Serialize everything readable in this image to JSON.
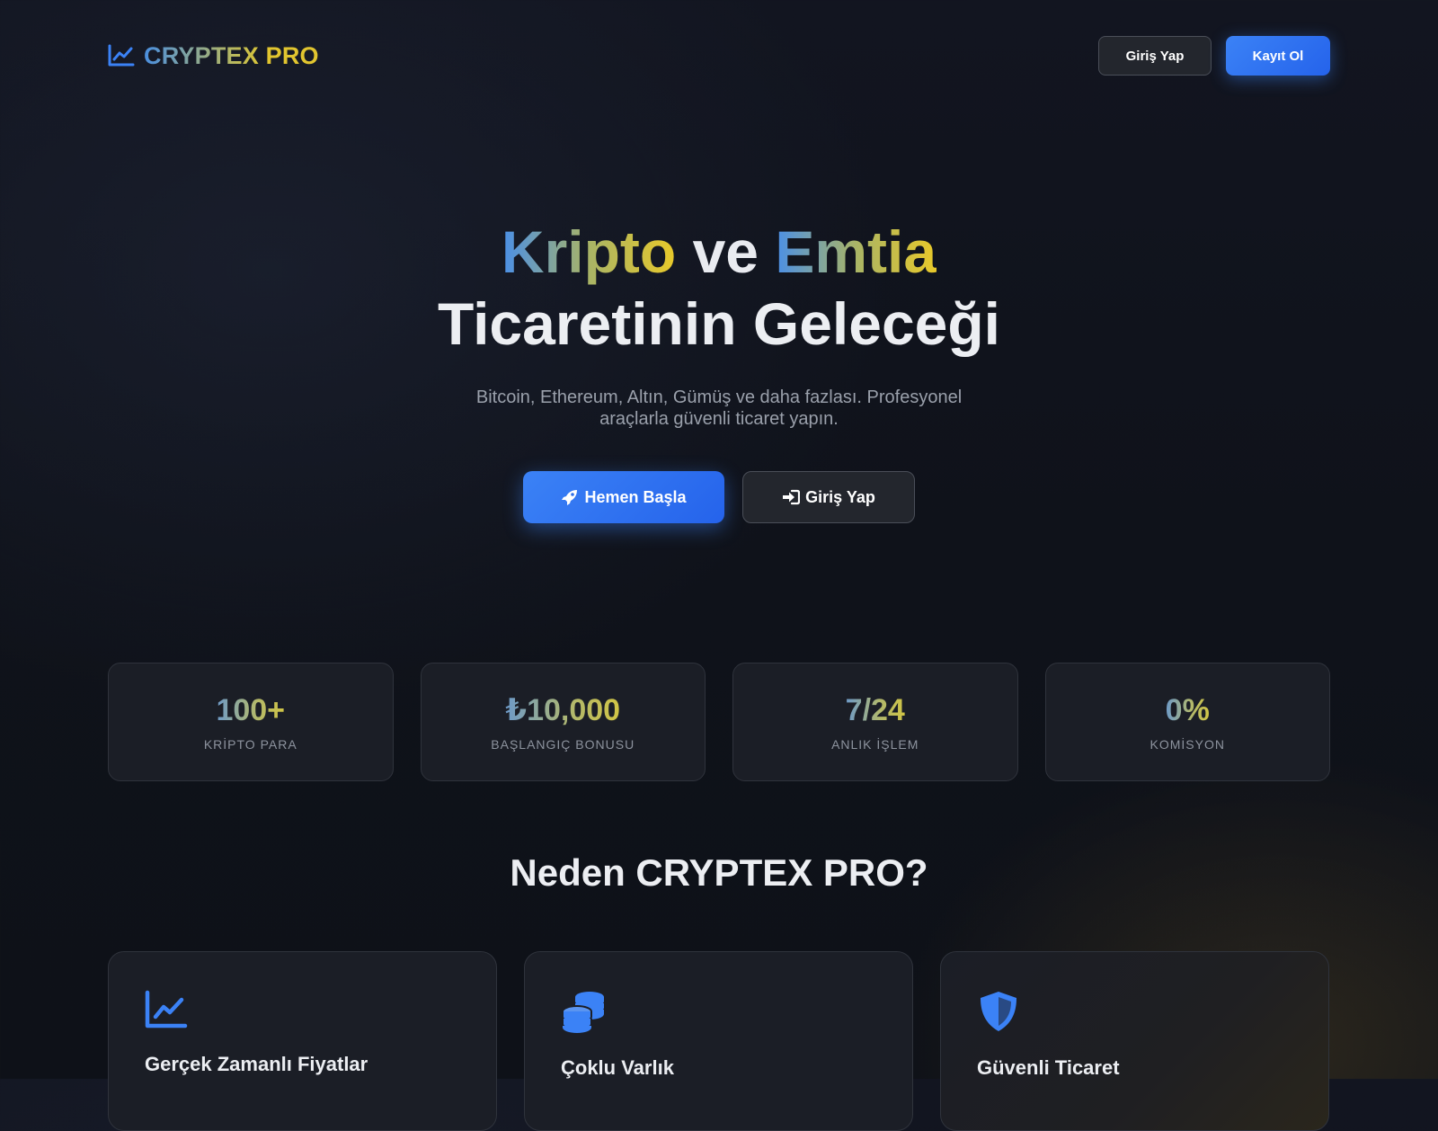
{
  "colors": {
    "background": "#0f121a",
    "accent_blue": "#3b82f6",
    "accent_gold": "#e1c52f",
    "card_bg": "#1b1e26",
    "card_border": "#2f333c"
  },
  "brand": {
    "icon": "chart-line-icon",
    "name_part1": "CRYPTEX",
    "name_part2": "PRO"
  },
  "nav": {
    "login_label": "Giriş Yap",
    "register_label": "Kayıt Ol"
  },
  "hero": {
    "word1": "Kripto",
    "word2": "ve",
    "word3": "Emtia",
    "line2": "Ticaretinin Geleceği",
    "subtitle": "Bitcoin, Ethereum, Altın, Gümüş ve daha fazlası. Profesyonel araçlarla güvenli ticaret yapın.",
    "start_label": "Hemen Başla",
    "start_icon": "rocket-icon",
    "login_label": "Giriş Yap",
    "login_icon": "sign-in-icon"
  },
  "stats": [
    {
      "value": "100+",
      "label": "KRİPTO PARA"
    },
    {
      "value": "₺10,000",
      "label": "BAŞLANGIÇ BONUSU"
    },
    {
      "value": "7/24",
      "label": "ANLIK İŞLEM"
    },
    {
      "value": "0%",
      "label": "KOMİSYON"
    }
  ],
  "why": {
    "title": "Neden CRYPTEX PRO?",
    "features": [
      {
        "icon": "chart-line-icon",
        "title": "Gerçek Zamanlı Fiyatlar"
      },
      {
        "icon": "coins-icon",
        "title": "Çoklu Varlık"
      },
      {
        "icon": "shield-icon",
        "title": "Güvenli Ticaret"
      }
    ]
  }
}
